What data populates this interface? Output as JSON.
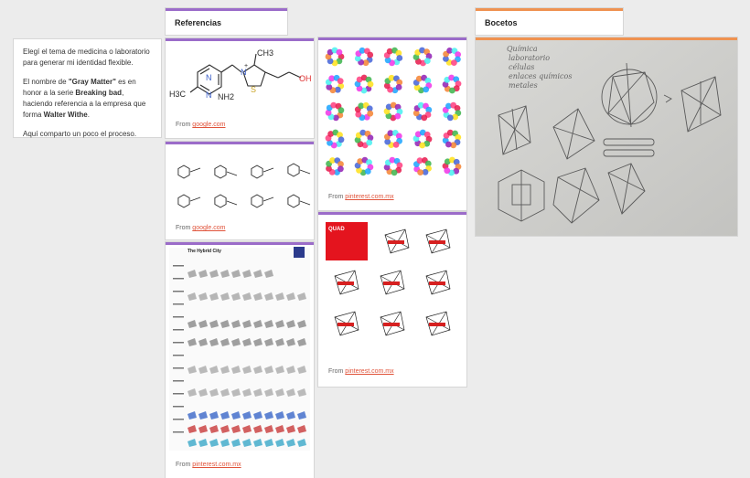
{
  "columns": {
    "referencias": {
      "title": "Referencias"
    },
    "bocetos": {
      "title": "Bocetos"
    }
  },
  "note": {
    "p1": "Elegí el tema de medicina o laboratorio para generar mi identidad flexible.",
    "p2_a": "El nombre de ",
    "p2_b": "\"Gray Matter\"",
    "p2_c": " es en honor a la serie ",
    "p2_d": "Breaking bad",
    "p2_e": ", haciendo referencia a la empresa que forma ",
    "p2_f": "Walter Withe",
    "p2_g": ".",
    "p3": "Aquí comparto un poco el proceso."
  },
  "cards": {
    "molecule1": {
      "from": "From",
      "source": "google.com",
      "labels": {
        "ch3": "H3C",
        "nh2": "NH2",
        "n1": "N",
        "n2": "N",
        "nplus": "N",
        "plus": "+",
        "s": "S",
        "ch3b": "CH3",
        "oh": "OH"
      }
    },
    "polymer": {
      "from": "From",
      "source": "google.com"
    },
    "hybrid": {
      "from": "From",
      "source": "pinterest.com.mx",
      "title": "The Hybrid City"
    },
    "dots": {
      "from": "From",
      "source": "pinterest.com.mx"
    },
    "quad": {
      "from": "From",
      "source": "pinterest.com.mx",
      "logo": "QUAD"
    }
  },
  "sketch": {
    "words": [
      "Química",
      "laboratorio",
      "células",
      "enlaces químicos",
      "metales"
    ]
  },
  "colors": {
    "purple": "#9b6cc9",
    "orange": "#ef9251",
    "link": "#e0533a"
  }
}
